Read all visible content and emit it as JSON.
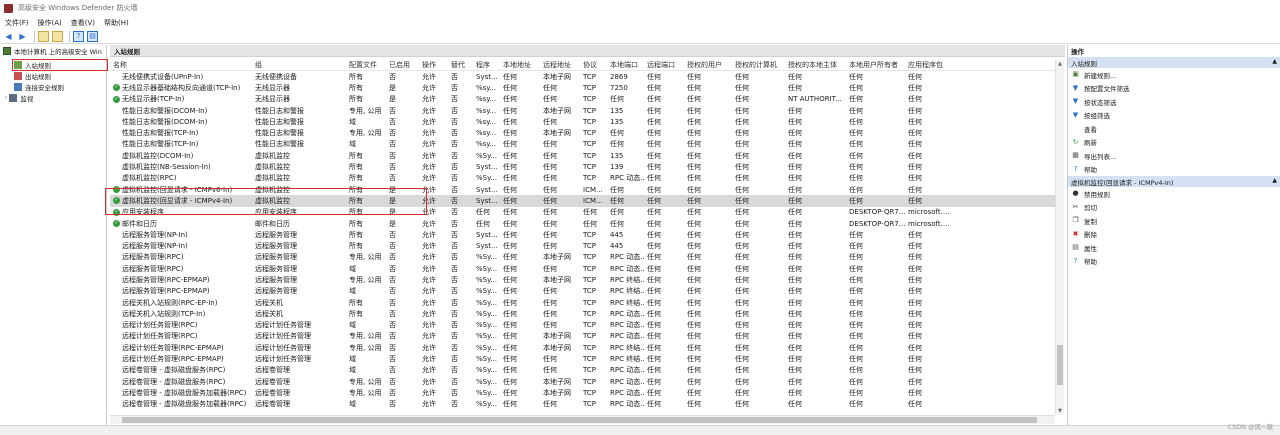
{
  "window": {
    "title": "高级安全 Windows Defender 防火墙"
  },
  "menu": [
    "文件(F)",
    "操作(A)",
    "查看(V)",
    "帮助(H)"
  ],
  "toolbar": {
    "icons": [
      "back-arrow-icon",
      "forward-arrow-icon",
      "folder-up-icon",
      "properties-icon",
      "help-icon",
      "console-icon"
    ]
  },
  "tree": {
    "root": "本地计算机 上的高级安全 Win",
    "items": [
      "入站规则",
      "出站规则",
      "连接安全规则",
      "监视"
    ]
  },
  "center": {
    "title": "入站规则",
    "columns": [
      "名称",
      "组",
      "配置文件",
      "已启用",
      "操作",
      "替代",
      "程序",
      "本地地址",
      "远程地址",
      "协议",
      "本地端口",
      "远程端口",
      "授权的用户",
      "授权的计算机",
      "授权的本地主体",
      "本地用户所有者",
      "应用程序包"
    ],
    "rows": [
      {
        "c": [
          "无线便携式设备(UPnP-In)",
          "无线便携设备",
          "所有",
          "否",
          "允许",
          "否",
          "Syst...",
          "任何",
          "本地子网",
          "TCP",
          "2869",
          "任何",
          "任何",
          "任何",
          "任何",
          "任何",
          "任何"
        ],
        "e": false
      },
      {
        "c": [
          "无线显示器基础结构反向通道(TCP-In)",
          "无线显示器",
          "所有",
          "是",
          "允许",
          "否",
          "%sy...",
          "任何",
          "任何",
          "TCP",
          "7250",
          "任何",
          "任何",
          "任何",
          "任何",
          "任何",
          "任何"
        ],
        "e": true
      },
      {
        "c": [
          "无线显示器(TCP-In)",
          "无线显示器",
          "所有",
          "是",
          "允许",
          "否",
          "%sy...",
          "任何",
          "任何",
          "TCP",
          "任何",
          "任何",
          "任何",
          "任何",
          "NT AUTHORIT...",
          "任何",
          "任何"
        ],
        "e": true
      },
      {
        "c": [
          "性能日志和警报(DCOM-In)",
          "性能日志和警报",
          "专用, 公用",
          "否",
          "允许",
          "否",
          "%sy...",
          "任何",
          "本地子网",
          "TCP",
          "135",
          "任何",
          "任何",
          "任何",
          "任何",
          "任何",
          "任何"
        ],
        "e": false
      },
      {
        "c": [
          "性能日志和警报(DCOM-In)",
          "性能日志和警报",
          "域",
          "否",
          "允许",
          "否",
          "%sy...",
          "任何",
          "任何",
          "TCP",
          "135",
          "任何",
          "任何",
          "任何",
          "任何",
          "任何",
          "任何"
        ],
        "e": false
      },
      {
        "c": [
          "性能日志和警报(TCP-In)",
          "性能日志和警报",
          "专用, 公用",
          "否",
          "允许",
          "否",
          "%sy...",
          "任何",
          "本地子网",
          "TCP",
          "任何",
          "任何",
          "任何",
          "任何",
          "任何",
          "任何",
          "任何"
        ],
        "e": false
      },
      {
        "c": [
          "性能日志和警报(TCP-In)",
          "性能日志和警报",
          "域",
          "否",
          "允许",
          "否",
          "%sy...",
          "任何",
          "任何",
          "TCP",
          "任何",
          "任何",
          "任何",
          "任何",
          "任何",
          "任何",
          "任何"
        ],
        "e": false
      },
      {
        "c": [
          "虚拟机监控(DCOM-In)",
          "虚拟机监控",
          "所有",
          "否",
          "允许",
          "否",
          "%Sy...",
          "任何",
          "任何",
          "TCP",
          "135",
          "任何",
          "任何",
          "任何",
          "任何",
          "任何",
          "任何"
        ],
        "e": false
      },
      {
        "c": [
          "虚拟机监控(NB-Session-In)",
          "虚拟机监控",
          "所有",
          "否",
          "允许",
          "否",
          "Syst...",
          "任何",
          "任何",
          "TCP",
          "139",
          "任何",
          "任何",
          "任何",
          "任何",
          "任何",
          "任何"
        ],
        "e": false
      },
      {
        "c": [
          "虚拟机监控(RPC)",
          "虚拟机监控",
          "所有",
          "否",
          "允许",
          "否",
          "%Sy...",
          "任何",
          "任何",
          "TCP",
          "RPC 动态...",
          "任何",
          "任何",
          "任何",
          "任何",
          "任何",
          "任何"
        ],
        "e": false
      },
      {
        "c": [
          "虚拟机监控(回显请求 - ICMPv6-In)",
          "虚拟机监控",
          "所有",
          "是",
          "允许",
          "否",
          "Syst...",
          "任何",
          "任何",
          "ICM...",
          "任何",
          "任何",
          "任何",
          "任何",
          "任何",
          "任何",
          "任何"
        ],
        "e": true
      },
      {
        "c": [
          "虚拟机监控(回显请求 - ICMPv4-In)",
          "虚拟机监控",
          "所有",
          "是",
          "允许",
          "否",
          "Syst...",
          "任何",
          "任何",
          "ICM...",
          "任何",
          "任何",
          "任何",
          "任何",
          "任何",
          "任何",
          "任何"
        ],
        "e": true,
        "sel": true
      },
      {
        "c": [
          "应用安装程序",
          "应用安装程序",
          "所有",
          "是",
          "允许",
          "否",
          "任何",
          "任何",
          "任何",
          "任何",
          "任何",
          "任何",
          "任何",
          "任何",
          "任何",
          "DESKTOP-QR7...",
          "microsoft...."
        ],
        "e": true
      },
      {
        "c": [
          "邮件和日历",
          "邮件和日历",
          "所有",
          "是",
          "允许",
          "否",
          "任何",
          "任何",
          "任何",
          "任何",
          "任何",
          "任何",
          "任何",
          "任何",
          "任何",
          "DESKTOP-QR7...",
          "microsoft...."
        ],
        "e": true
      },
      {
        "c": [
          "远程服务管理(NP-In)",
          "远程服务管理",
          "所有",
          "否",
          "允许",
          "否",
          "Syst...",
          "任何",
          "任何",
          "TCP",
          "445",
          "任何",
          "任何",
          "任何",
          "任何",
          "任何",
          "任何"
        ],
        "e": false
      },
      {
        "c": [
          "远程服务管理(NP-In)",
          "远程服务管理",
          "所有",
          "否",
          "允许",
          "否",
          "Syst...",
          "任何",
          "任何",
          "TCP",
          "445",
          "任何",
          "任何",
          "任何",
          "任何",
          "任何",
          "任何"
        ],
        "e": false
      },
      {
        "c": [
          "远程服务管理(RPC)",
          "远程服务管理",
          "专用, 公用",
          "否",
          "允许",
          "否",
          "%Sy...",
          "任何",
          "本地子网",
          "TCP",
          "RPC 动态...",
          "任何",
          "任何",
          "任何",
          "任何",
          "任何",
          "任何"
        ],
        "e": false
      },
      {
        "c": [
          "远程服务管理(RPC)",
          "远程服务管理",
          "域",
          "否",
          "允许",
          "否",
          "%Sy...",
          "任何",
          "任何",
          "TCP",
          "RPC 动态...",
          "任何",
          "任何",
          "任何",
          "任何",
          "任何",
          "任何"
        ],
        "e": false
      },
      {
        "c": [
          "远程服务管理(RPC-EPMAP)",
          "远程服务管理",
          "专用, 公用",
          "否",
          "允许",
          "否",
          "%Sy...",
          "任何",
          "本地子网",
          "TCP",
          "RPC 终结...",
          "任何",
          "任何",
          "任何",
          "任何",
          "任何",
          "任何"
        ],
        "e": false
      },
      {
        "c": [
          "远程服务管理(RPC-EPMAP)",
          "远程服务管理",
          "域",
          "否",
          "允许",
          "否",
          "%Sy...",
          "任何",
          "任何",
          "TCP",
          "RPC 终结...",
          "任何",
          "任何",
          "任何",
          "任何",
          "任何",
          "任何"
        ],
        "e": false
      },
      {
        "c": [
          "远程关机入站规则(RPC-EP-In)",
          "远程关机",
          "所有",
          "否",
          "允许",
          "否",
          "%Sy...",
          "任何",
          "任何",
          "TCP",
          "RPC 终结...",
          "任何",
          "任何",
          "任何",
          "任何",
          "任何",
          "任何"
        ],
        "e": false
      },
      {
        "c": [
          "远程关机入站规则(TCP-In)",
          "远程关机",
          "所有",
          "否",
          "允许",
          "否",
          "%Sy...",
          "任何",
          "任何",
          "TCP",
          "RPC 动态...",
          "任何",
          "任何",
          "任何",
          "任何",
          "任何",
          "任何"
        ],
        "e": false
      },
      {
        "c": [
          "远程计划任务管理(RPC)",
          "远程计划任务管理",
          "域",
          "否",
          "允许",
          "否",
          "%Sy...",
          "任何",
          "任何",
          "TCP",
          "RPC 动态...",
          "任何",
          "任何",
          "任何",
          "任何",
          "任何",
          "任何"
        ],
        "e": false
      },
      {
        "c": [
          "远程计划任务管理(RPC)",
          "远程计划任务管理",
          "专用, 公用",
          "否",
          "允许",
          "否",
          "%Sy...",
          "任何",
          "本地子网",
          "TCP",
          "RPC 动态...",
          "任何",
          "任何",
          "任何",
          "任何",
          "任何",
          "任何"
        ],
        "e": false
      },
      {
        "c": [
          "远程计划任务管理(RPC-EPMAP)",
          "远程计划任务管理",
          "专用, 公用",
          "否",
          "允许",
          "否",
          "%Sy...",
          "任何",
          "本地子网",
          "TCP",
          "RPC 终结...",
          "任何",
          "任何",
          "任何",
          "任何",
          "任何",
          "任何"
        ],
        "e": false
      },
      {
        "c": [
          "远程计划任务管理(RPC-EPMAP)",
          "远程计划任务管理",
          "域",
          "否",
          "允许",
          "否",
          "%Sy...",
          "任何",
          "任何",
          "TCP",
          "RPC 终结...",
          "任何",
          "任何",
          "任何",
          "任何",
          "任何",
          "任何"
        ],
        "e": false
      },
      {
        "c": [
          "远程卷管理 - 虚拟磁盘服务(RPC)",
          "远程卷管理",
          "域",
          "否",
          "允许",
          "否",
          "%Sy...",
          "任何",
          "任何",
          "TCP",
          "RPC 动态...",
          "任何",
          "任何",
          "任何",
          "任何",
          "任何",
          "任何"
        ],
        "e": false
      },
      {
        "c": [
          "远程卷管理 - 虚拟磁盘服务(RPC)",
          "远程卷管理",
          "专用, 公用",
          "否",
          "允许",
          "否",
          "%Sy...",
          "任何",
          "本地子网",
          "TCP",
          "RPC 动态...",
          "任何",
          "任何",
          "任何",
          "任何",
          "任何",
          "任何"
        ],
        "e": false
      },
      {
        "c": [
          "远程卷管理 - 虚拟磁盘服务加载器(RPC)",
          "远程卷管理",
          "专用, 公用",
          "否",
          "允许",
          "否",
          "%Sy...",
          "任何",
          "本地子网",
          "TCP",
          "RPC 动态...",
          "任何",
          "任何",
          "任何",
          "任何",
          "任何",
          "任何"
        ],
        "e": false
      },
      {
        "c": [
          "远程卷管理 - 虚拟磁盘服务加载器(RPC)",
          "远程卷管理",
          "域",
          "否",
          "允许",
          "否",
          "%Sy...",
          "任何",
          "任何",
          "TCP",
          "RPC 动态...",
          "任何",
          "任何",
          "任何",
          "任何",
          "任何",
          "任何"
        ],
        "e": false
      }
    ]
  },
  "actions": {
    "title": "操作",
    "section1": "入站规则",
    "items1": [
      {
        "label": "新建规则...",
        "icon": "new-rule-icon"
      },
      {
        "label": "按配置文件筛选",
        "icon": "filter-icon"
      },
      {
        "label": "按状态筛选",
        "icon": "filter-icon"
      },
      {
        "label": "按组筛选",
        "icon": "filter-icon"
      },
      {
        "label": "查看",
        "icon": "view-icon"
      },
      {
        "label": "刷新",
        "icon": "refresh-icon"
      },
      {
        "label": "导出列表...",
        "icon": "export-icon"
      },
      {
        "label": "帮助",
        "icon": "help-icon"
      }
    ],
    "section2": "虚拟机监控(回显请求 - ICMPv4-In)",
    "items2": [
      {
        "label": "禁用规则",
        "icon": "disable-icon"
      },
      {
        "label": "剪切",
        "icon": "cut-icon"
      },
      {
        "label": "复制",
        "icon": "copy-icon"
      },
      {
        "label": "删除",
        "icon": "delete-icon"
      },
      {
        "label": "属性",
        "icon": "properties-icon"
      },
      {
        "label": "帮助",
        "icon": "help-icon"
      }
    ]
  },
  "watermark": "CSDN @风~疏"
}
